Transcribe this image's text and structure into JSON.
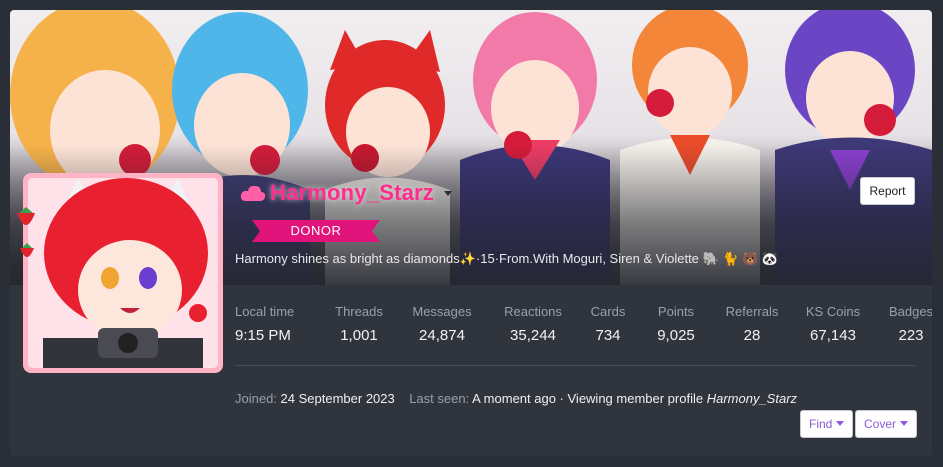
{
  "profile": {
    "username": "Harmony_Starz",
    "banner": "DONOR",
    "bio": "Harmony shines as bright as diamonds✨·15·From.With Moguri, Siren & Violette 🐘 🐈 🐻 🐼",
    "report_label": "Report"
  },
  "stats": [
    {
      "label": "Local time",
      "value": "9:15 PM"
    },
    {
      "label": "Threads",
      "value": "1,001"
    },
    {
      "label": "Messages",
      "value": "24,874"
    },
    {
      "label": "Reactions",
      "value": "35,244"
    },
    {
      "label": "Cards",
      "value": "734"
    },
    {
      "label": "Points",
      "value": "9,025"
    },
    {
      "label": "Referrals",
      "value": "28"
    },
    {
      "label": "KS Coins",
      "value": "67,143"
    },
    {
      "label": "Badges",
      "value": "223"
    }
  ],
  "meta": {
    "joined_label": "Joined:",
    "joined_value": "24 September 2023",
    "last_seen_label": "Last seen:",
    "last_seen_value": "A moment ago · Viewing member profile",
    "last_seen_profile": "Harmony_Starz"
  },
  "actions": {
    "find_label": "Find",
    "cover_label": "Cover"
  },
  "colors": {
    "username": "#ff2d8a",
    "banner": "#e0147a",
    "button_text": "#8a5bd6",
    "avatar_border": "#ffb4c6"
  },
  "icons": {
    "name_prefix": "cloud-icon",
    "name_menu": "caret-down-icon",
    "dropdown": "caret-down-icon"
  }
}
